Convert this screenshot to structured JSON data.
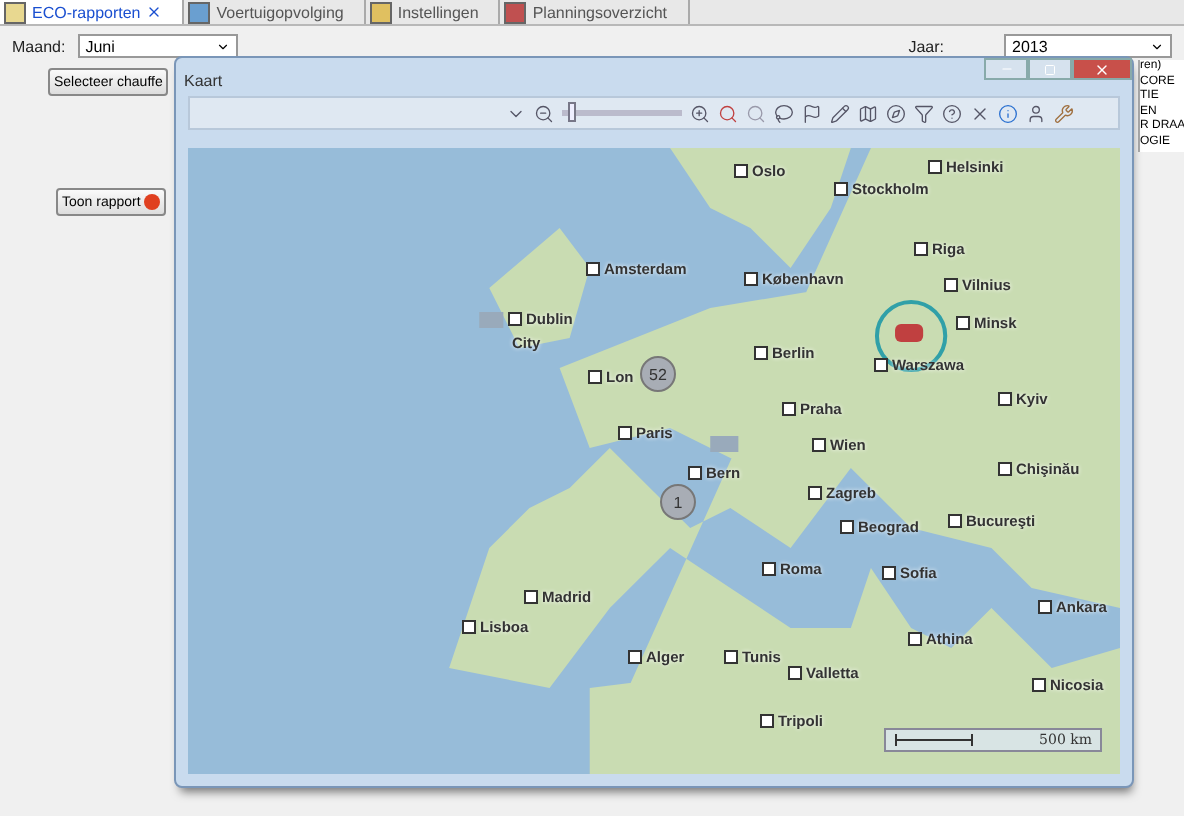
{
  "tabs": [
    {
      "label": "ECO-rapporten",
      "selected": true,
      "closable": true
    },
    {
      "label": "Voertuigopvolging",
      "selected": false,
      "closable": false
    },
    {
      "label": "Instellingen",
      "selected": false,
      "closable": false
    },
    {
      "label": "Planningsoverzicht",
      "selected": false,
      "closable": false
    }
  ],
  "filters": {
    "month_label": "Maand:",
    "month_value": "Juni",
    "year_label": "Jaar:",
    "year_value": "2013"
  },
  "buttons": {
    "select_driver": "Selecteer chauffe",
    "show_report": "Toon rapport",
    "show_report_warning": true
  },
  "background_list": [
    "ren)",
    "CORE",
    "TIE",
    "EN",
    "R DRAA",
    "OGIE"
  ],
  "map_window": {
    "title": "Kaart",
    "zoom_slider": {
      "level": 0.05
    },
    "cities": [
      {
        "name": "Oslo"
      },
      {
        "name": "Helsinki"
      },
      {
        "name": "Stockholm"
      },
      {
        "name": "Riga"
      },
      {
        "name": "København"
      },
      {
        "name": "Vilnius"
      },
      {
        "name": "Minsk"
      },
      {
        "name": "Dublin"
      },
      {
        "name": "City"
      },
      {
        "name": "Amsterdam"
      },
      {
        "name": "Lon"
      },
      {
        "name": "Berlin"
      },
      {
        "name": "Warszawa"
      },
      {
        "name": "Praha"
      },
      {
        "name": "Paris"
      },
      {
        "name": "Wien"
      },
      {
        "name": "Kyiv"
      },
      {
        "name": "Bern"
      },
      {
        "name": "Zagreb"
      },
      {
        "name": "Chişinău"
      },
      {
        "name": "Beograd"
      },
      {
        "name": "Bucureşti"
      },
      {
        "name": "Madrid"
      },
      {
        "name": "Sofia"
      },
      {
        "name": "Roma"
      },
      {
        "name": "Lisboa"
      },
      {
        "name": "Ankara"
      },
      {
        "name": "Alger"
      },
      {
        "name": "Tunis"
      },
      {
        "name": "Valletta"
      },
      {
        "name": "Athina"
      },
      {
        "name": "Tripoli"
      },
      {
        "name": "Nicosia"
      }
    ],
    "clusters": [
      {
        "count": "52"
      },
      {
        "count": "1"
      }
    ],
    "scale": "500 km"
  }
}
